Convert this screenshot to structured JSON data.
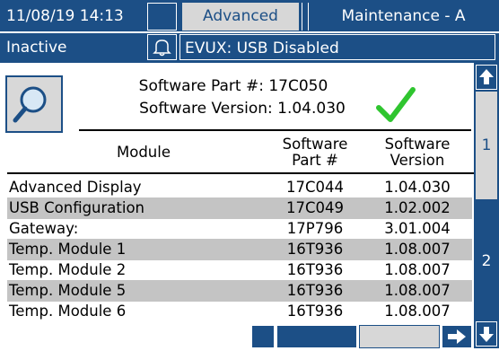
{
  "header": {
    "datetime": "11/08/19 14:13",
    "tab_active": "Advanced",
    "tab_other": "Maintenance - A",
    "status": "Inactive",
    "alarm_text": "EVUX: USB Disabled"
  },
  "info": {
    "part": "Software Part #: 17C050",
    "version": "Software Version: 1.04.030"
  },
  "table": {
    "col_module": "Module",
    "col_part_1": "Software",
    "col_part_2": "Part #",
    "col_ver_1": "Software",
    "col_ver_2": "Version",
    "rows": [
      {
        "module": "Advanced Display",
        "part": "17C044",
        "version": "1.04.030"
      },
      {
        "module": "USB Configuration",
        "part": "17C049",
        "version": "1.02.002"
      },
      {
        "module": "Gateway:",
        "part": "17P796",
        "version": "3.01.004"
      },
      {
        "module": "Temp. Module 1",
        "part": "16T936",
        "version": "1.08.007"
      },
      {
        "module": "Temp. Module 2",
        "part": "16T936",
        "version": "1.08.007"
      },
      {
        "module": "Temp. Module 5",
        "part": "16T936",
        "version": "1.08.007"
      },
      {
        "module": "Temp. Module 6",
        "part": "16T936",
        "version": "1.08.007"
      }
    ]
  },
  "pager": {
    "page1": "1",
    "page2": "2"
  },
  "colors": {
    "bar_blue": "#1c4f86",
    "row_gray": "#c4c4c4",
    "check_green": "#2fc52f"
  },
  "icons": [
    "search-icon",
    "bell-icon",
    "check-icon",
    "arrow-up-icon",
    "arrow-down-icon",
    "arrow-right-icon"
  ]
}
